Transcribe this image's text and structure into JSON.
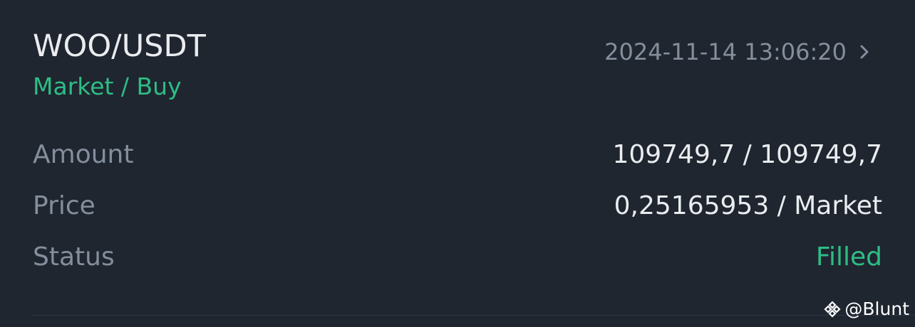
{
  "order": {
    "pair": "WOO/USDT",
    "type": "Market / Buy",
    "time": "2024-11-14 13:06:20"
  },
  "details": {
    "amount_label": "Amount",
    "amount_value": "109749,7 / 109749,7",
    "price_label": "Price",
    "price_value": "0,25165953 / Market",
    "status_label": "Status",
    "status_value": "Filled"
  },
  "watermark": {
    "handle": "@Blunt",
    "icon": "binance-logo-icon"
  },
  "colors": {
    "background": "#1f2630",
    "buy_green": "#2ebd85",
    "muted_text": "#848e9c",
    "primary_text": "#eaecef"
  }
}
